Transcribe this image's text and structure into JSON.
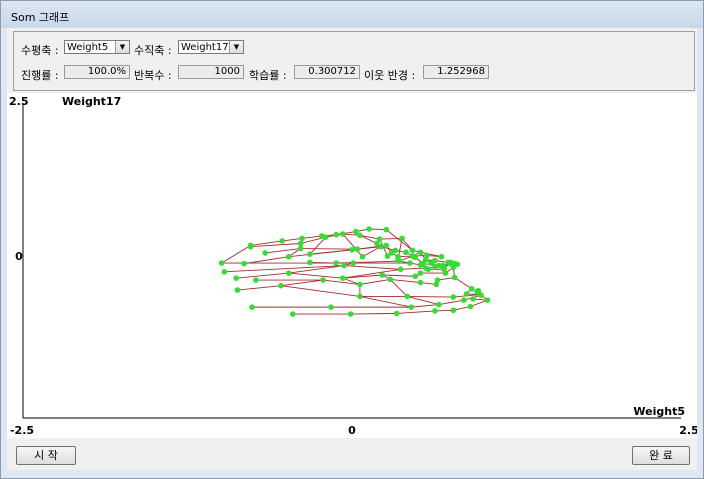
{
  "window": {
    "title": "Som 그래프"
  },
  "params": {
    "x_axis_label": "수평축 :",
    "x_axis_value": "Weight5",
    "y_axis_label": "수직축 :",
    "y_axis_value": "Weight17",
    "progress_label": "진행률 :",
    "progress_value": "100.0%",
    "iterations_label": "반복수 :",
    "iterations_value": "1000",
    "learning_rate_label": "학습률 :",
    "learning_rate_value": "0.300712",
    "neighborhood_label": "이웃 반경 :",
    "neighborhood_value": "1.252968"
  },
  "buttons": {
    "start": "시 작",
    "done": "완 료"
  },
  "chart_data": {
    "type": "scatter",
    "title": "",
    "xlabel": "Weight5",
    "ylabel": "Weight17",
    "xlim": [
      -2.5,
      2.5
    ],
    "ylim": [
      -2.5,
      2.5
    ],
    "x_ticks": [
      "-2.5",
      "0",
      "2.5"
    ],
    "y_ticks": [
      "2.5",
      "0"
    ],
    "grid": false,
    "node_color": "#33dd33",
    "edge_color": "#a52a2a",
    "nodes": [
      [
        -0.77,
        0.24
      ],
      [
        -0.53,
        0.31
      ],
      [
        -0.38,
        0.35
      ],
      [
        -0.23,
        0.39
      ],
      [
        -0.12,
        0.41
      ],
      [
        0.03,
        0.46
      ],
      [
        0.13,
        0.5
      ],
      [
        0.26,
        0.49
      ],
      [
        -0.77,
        0.22
      ],
      [
        -0.39,
        0.27
      ],
      [
        -0.2,
        0.37
      ],
      [
        -0.07,
        0.42
      ],
      [
        0.06,
        0.4
      ],
      [
        0.21,
        0.34
      ],
      [
        0.38,
        0.35
      ],
      [
        0.46,
        0.16
      ],
      [
        -0.66,
        0.12
      ],
      [
        -0.39,
        0.19
      ],
      [
        0.04,
        0.18
      ],
      [
        0.26,
        0.24
      ],
      [
        0.3,
        0.12
      ],
      [
        0.35,
        0.06
      ],
      [
        0.57,
        0.08
      ],
      [
        0.68,
        0.06
      ],
      [
        -0.82,
        -0.05
      ],
      [
        -0.32,
        0.1
      ],
      [
        0.08,
        0.06
      ],
      [
        0.19,
        0.27
      ],
      [
        0.27,
        0.07
      ],
      [
        0.35,
        0.02
      ],
      [
        0.6,
        -0.04
      ],
      [
        0.75,
        -0.03
      ],
      [
        -0.48,
        0.06
      ],
      [
        0.0,
        0.17
      ],
      [
        0.22,
        0.22
      ],
      [
        0.33,
        0.16
      ],
      [
        0.41,
        0.13
      ],
      [
        0.48,
        0.05
      ],
      [
        0.54,
        -0.05
      ],
      [
        0.69,
        -0.08
      ],
      [
        -0.32,
        -0.03
      ],
      [
        -0.12,
        -0.04
      ],
      [
        0.36,
        -0.01
      ],
      [
        0.46,
        0.07
      ],
      [
        0.52,
        0.13
      ],
      [
        0.56,
        0.01
      ],
      [
        0.63,
        0.0
      ],
      [
        0.73,
        -0.03
      ],
      [
        -0.99,
        -0.04
      ],
      [
        0.01,
        -0.04
      ],
      [
        0.44,
        -0.04
      ],
      [
        0.52,
        -0.07
      ],
      [
        0.58,
        -0.14
      ],
      [
        0.7,
        -0.14
      ],
      [
        0.66,
        -0.08
      ],
      [
        0.8,
        -0.06
      ],
      [
        -0.97,
        -0.18
      ],
      [
        -0.06,
        -0.08
      ],
      [
        0.37,
        -0.14
      ],
      [
        0.56,
        -0.12
      ],
      [
        0.63,
        -0.1
      ],
      [
        0.7,
        -0.11
      ],
      [
        0.75,
        -0.05
      ],
      [
        0.78,
        -0.05
      ],
      [
        -0.88,
        -0.28
      ],
      [
        -0.48,
        -0.2
      ],
      [
        -0.07,
        -0.28
      ],
      [
        0.23,
        -0.23
      ],
      [
        0.48,
        -0.25
      ],
      [
        0.52,
        -0.2
      ],
      [
        0.71,
        -0.2
      ],
      [
        0.77,
        -0.11
      ],
      [
        -0.73,
        -0.31
      ],
      [
        -0.22,
        -0.31
      ],
      [
        0.06,
        -0.38
      ],
      [
        0.29,
        -0.3
      ],
      [
        0.52,
        -0.35
      ],
      [
        0.64,
        -0.38
      ],
      [
        0.65,
        -0.31
      ],
      [
        0.78,
        -0.27
      ],
      [
        -0.87,
        -0.47
      ],
      [
        -0.54,
        -0.4
      ],
      [
        0.06,
        -0.57
      ],
      [
        0.42,
        -0.57
      ],
      [
        0.77,
        -0.58
      ],
      [
        0.97,
        -0.54
      ],
      [
        0.87,
        -0.53
      ],
      [
        0.91,
        -0.45
      ],
      [
        -0.76,
        -0.74
      ],
      [
        -0.16,
        -0.74
      ],
      [
        0.45,
        -0.74
      ],
      [
        0.66,
        -0.7
      ],
      [
        0.85,
        -0.63
      ],
      [
        0.98,
        -0.55
      ],
      [
        0.95,
        -0.49
      ],
      [
        0.96,
        -0.48
      ],
      [
        -0.45,
        -0.85
      ],
      [
        -0.01,
        -0.85
      ],
      [
        0.34,
        -0.84
      ],
      [
        0.63,
        -0.8
      ],
      [
        0.77,
        -0.79
      ],
      [
        0.9,
        -0.73
      ],
      [
        1.03,
        -0.63
      ],
      [
        0.92,
        -0.61
      ]
    ],
    "edges": [
      [
        48,
        0
      ],
      [
        0,
        1
      ],
      [
        1,
        2
      ],
      [
        2,
        3
      ],
      [
        3,
        4
      ],
      [
        4,
        5
      ],
      [
        5,
        6
      ],
      [
        6,
        7
      ],
      [
        7,
        15
      ],
      [
        15,
        23
      ],
      [
        0,
        8
      ],
      [
        8,
        9
      ],
      [
        9,
        10
      ],
      [
        10,
        11
      ],
      [
        11,
        12
      ],
      [
        12,
        13
      ],
      [
        13,
        14
      ],
      [
        14,
        15
      ],
      [
        16,
        17
      ],
      [
        17,
        18
      ],
      [
        18,
        19
      ],
      [
        19,
        20
      ],
      [
        20,
        21
      ],
      [
        21,
        22
      ],
      [
        22,
        23
      ],
      [
        9,
        17
      ],
      [
        10,
        25
      ],
      [
        11,
        26
      ],
      [
        12,
        27
      ],
      [
        13,
        28
      ],
      [
        14,
        29
      ],
      [
        17,
        32
      ],
      [
        25,
        33
      ],
      [
        26,
        34
      ],
      [
        24,
        32
      ],
      [
        32,
        33
      ],
      [
        33,
        34
      ],
      [
        34,
        35
      ],
      [
        35,
        36
      ],
      [
        36,
        37
      ],
      [
        37,
        38
      ],
      [
        38,
        39
      ],
      [
        39,
        31
      ],
      [
        40,
        41
      ],
      [
        41,
        42
      ],
      [
        42,
        43
      ],
      [
        43,
        44
      ],
      [
        44,
        45
      ],
      [
        45,
        46
      ],
      [
        46,
        47
      ],
      [
        48,
        49
      ],
      [
        49,
        50
      ],
      [
        50,
        51
      ],
      [
        51,
        52
      ],
      [
        52,
        53
      ],
      [
        53,
        54
      ],
      [
        54,
        55
      ],
      [
        49,
        57
      ],
      [
        57,
        58
      ],
      [
        58,
        59
      ],
      [
        59,
        60
      ],
      [
        60,
        61
      ],
      [
        61,
        62
      ],
      [
        62,
        63
      ],
      [
        56,
        57
      ],
      [
        57,
        65
      ],
      [
        64,
        65
      ],
      [
        65,
        66
      ],
      [
        66,
        67
      ],
      [
        67,
        68
      ],
      [
        68,
        69
      ],
      [
        69,
        70
      ],
      [
        70,
        71
      ],
      [
        66,
        74
      ],
      [
        67,
        75
      ],
      [
        72,
        73
      ],
      [
        73,
        74
      ],
      [
        74,
        75
      ],
      [
        75,
        76
      ],
      [
        76,
        77
      ],
      [
        77,
        78
      ],
      [
        78,
        79
      ],
      [
        73,
        81
      ],
      [
        74,
        82
      ],
      [
        75,
        83
      ],
      [
        80,
        81
      ],
      [
        81,
        82
      ],
      [
        82,
        83
      ],
      [
        83,
        84
      ],
      [
        84,
        85
      ],
      [
        85,
        86
      ],
      [
        86,
        87
      ],
      [
        82,
        90
      ],
      [
        83,
        91
      ],
      [
        88,
        89
      ],
      [
        89,
        90
      ],
      [
        90,
        91
      ],
      [
        91,
        92
      ],
      [
        92,
        93
      ],
      [
        93,
        94
      ],
      [
        94,
        95
      ],
      [
        96,
        97
      ],
      [
        97,
        98
      ],
      [
        98,
        99
      ],
      [
        99,
        100
      ],
      [
        100,
        101
      ],
      [
        101,
        102
      ],
      [
        102,
        103
      ],
      [
        94,
        102
      ],
      [
        41,
        49
      ],
      [
        42,
        50
      ],
      [
        45,
        53
      ],
      [
        58,
        66
      ],
      [
        63,
        71
      ],
      [
        79,
        87
      ],
      [
        71,
        79
      ]
    ]
  }
}
